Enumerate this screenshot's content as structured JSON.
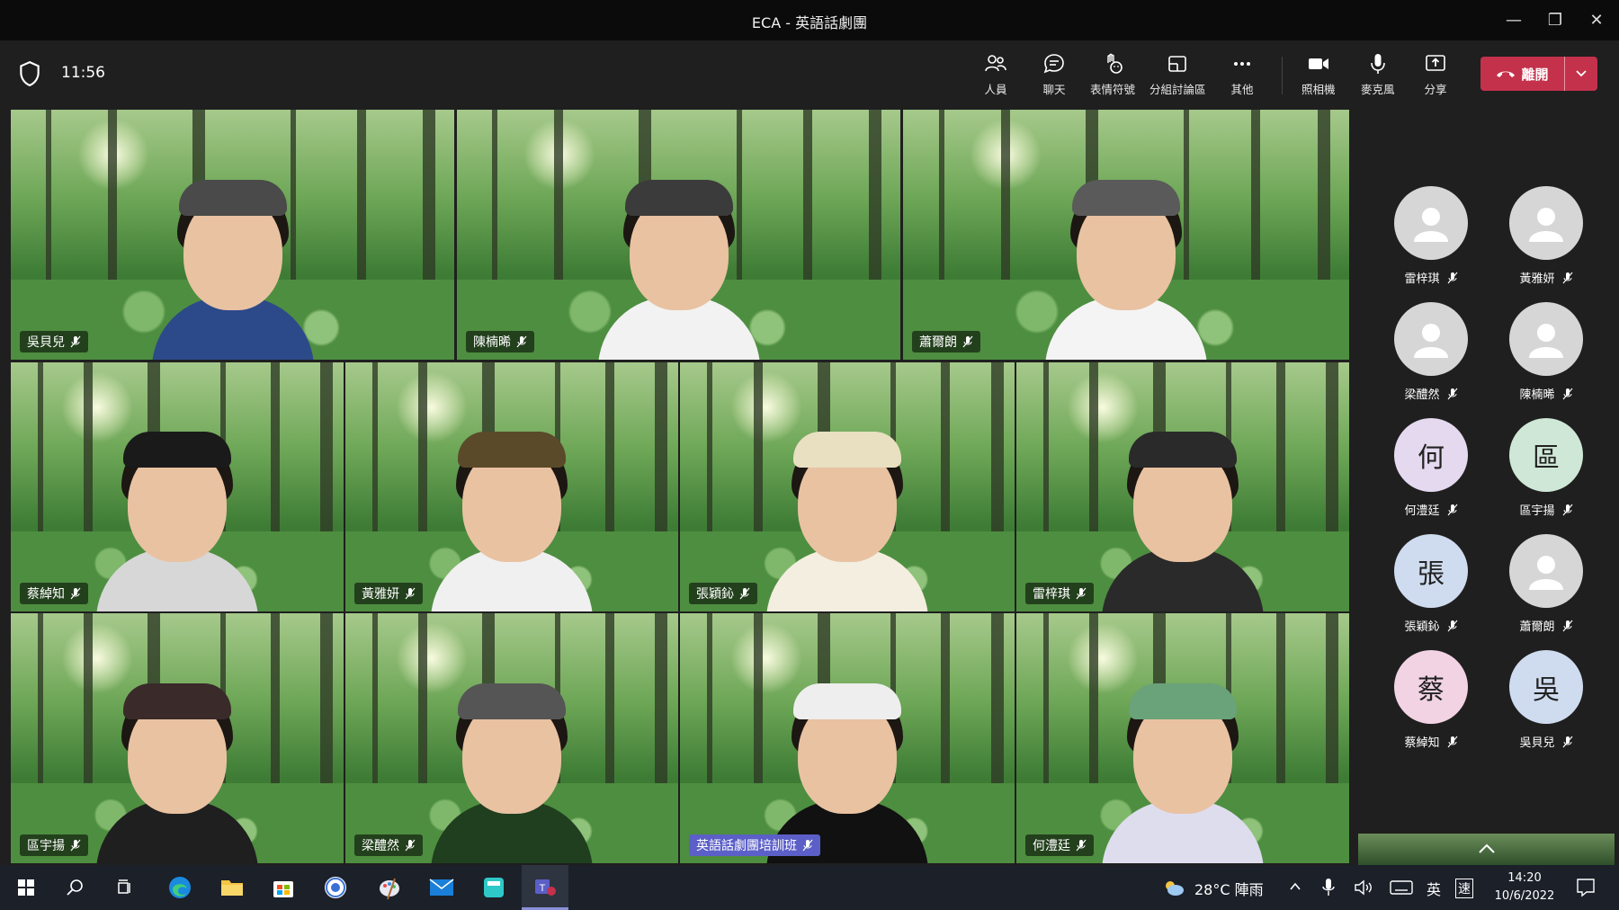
{
  "window": {
    "title": "ECA - 英語話劇團",
    "minimize": "—",
    "restore": "❐",
    "close": "✕"
  },
  "meeting": {
    "elapsed": "11:56",
    "toolbar": {
      "people": "人員",
      "chat": "聊天",
      "reactions": "表情符號",
      "breakout": "分組討論區",
      "more": "其他",
      "camera": "照相機",
      "mic": "麥克風",
      "share": "分享",
      "leave": "離開"
    }
  },
  "video_tiles": [
    {
      "name": "吳貝兒",
      "shirt": "#2c4a8a",
      "hat": "#4a4a4a"
    },
    {
      "name": "陳楠晞",
      "shirt": "#f2f2f2",
      "hat": "#3b3b3b"
    },
    {
      "name": "蕭爾朗",
      "shirt": "#f4f4f4",
      "hat": "#5a5a5a"
    },
    {
      "name": "蔡綽知",
      "shirt": "#d7d7d7",
      "hat": "#1a1a1a"
    },
    {
      "name": "黃雅妍",
      "shirt": "#f0f0f0",
      "hat": "#5a4a2a"
    },
    {
      "name": "張穎鈊",
      "shirt": "#f4eee0",
      "hat": "#e8e0c0"
    },
    {
      "name": "雷梓琪",
      "shirt": "#2a2a2a",
      "hat": "#2a2a2a"
    },
    {
      "name": "區宇揚",
      "shirt": "#1f1f1f",
      "hat": "#3a2a2a"
    },
    {
      "name": "梁醴然",
      "shirt": "#1f3f1f",
      "hat": "#555"
    },
    {
      "name": "英語話劇團培訓班",
      "shirt": "#111111",
      "hat": "#eee"
    },
    {
      "name": "何澧廷",
      "shirt": "#dde",
      "hat": "#6aa27a"
    }
  ],
  "roster": [
    {
      "name": "雷梓琪",
      "initial": "",
      "color": "gray"
    },
    {
      "name": "黃雅妍",
      "initial": "",
      "color": "gray"
    },
    {
      "name": "梁醴然",
      "initial": "",
      "color": "gray"
    },
    {
      "name": "陳楠晞",
      "initial": "",
      "color": "gray"
    },
    {
      "name": "何澧廷",
      "initial": "何",
      "color": "#e4d9ef"
    },
    {
      "name": "區宇揚",
      "initial": "區",
      "color": "#cfe7d6"
    },
    {
      "name": "張穎鈊",
      "initial": "張",
      "color": "#cfdcef"
    },
    {
      "name": "蕭爾朗",
      "initial": "",
      "color": "gray"
    },
    {
      "name": "蔡綽知",
      "initial": "蔡",
      "color": "#f2d3e3"
    },
    {
      "name": "吳貝兒",
      "initial": "吳",
      "color": "#cfdcef"
    }
  ],
  "taskbar": {
    "weather": "28°C 陣雨",
    "ime": "英",
    "ime2": "速",
    "time": "14:20",
    "date": "10/6/2022"
  }
}
